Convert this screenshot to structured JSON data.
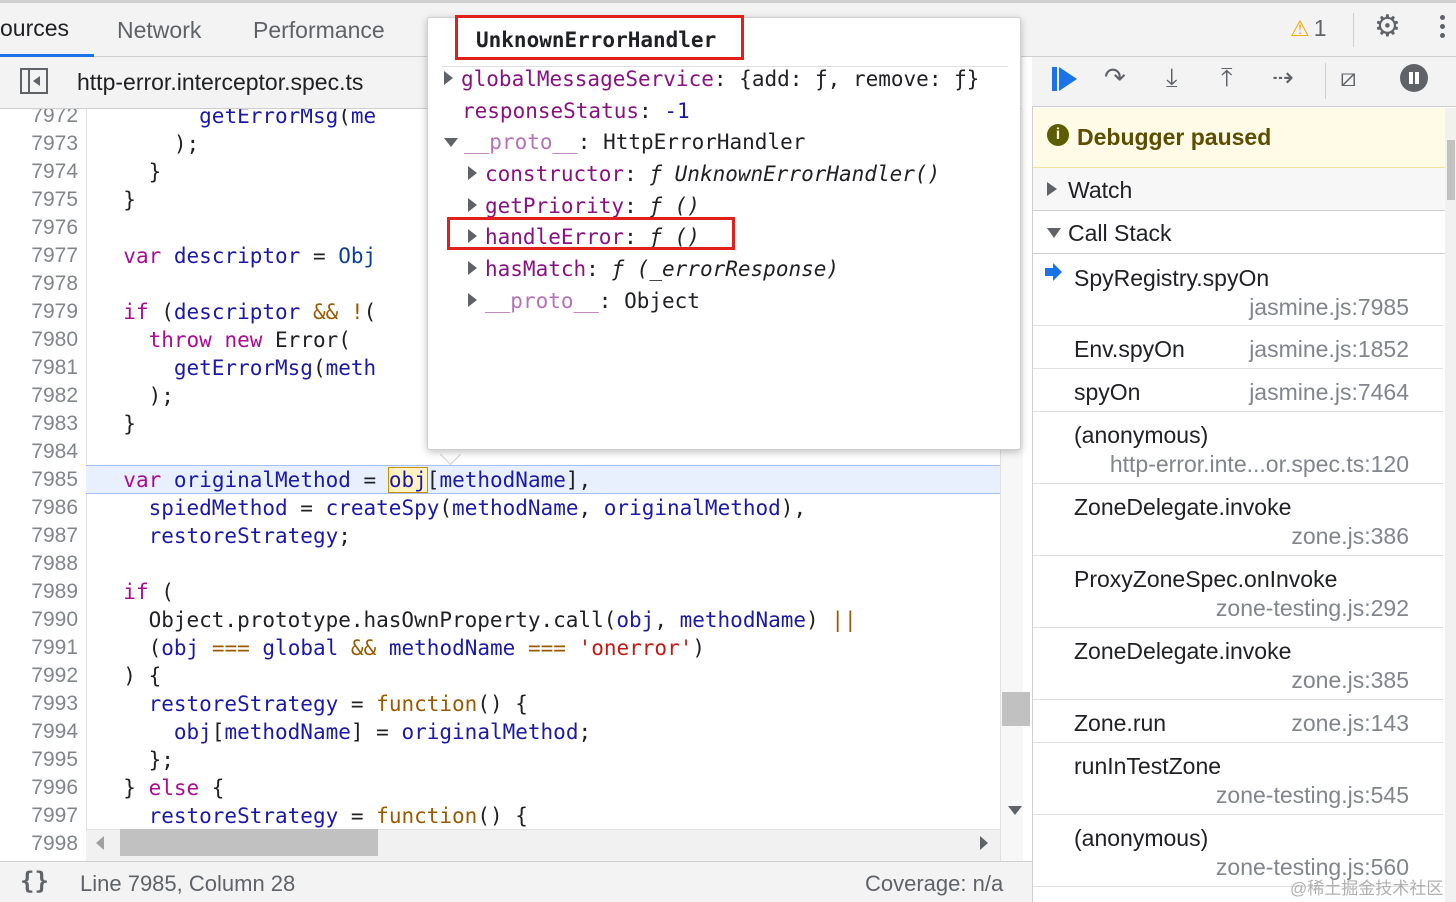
{
  "tabs": {
    "sources": "ources",
    "network": "Network",
    "performance": "Performance"
  },
  "warning_count": "1",
  "file_tab": "http-error.interceptor.spec.ts",
  "editor": {
    "lines": [
      {
        "n": "7972",
        "code": "        getErrorMsg(me"
      },
      {
        "n": "7973",
        "code": "      );"
      },
      {
        "n": "7974",
        "code": "    }"
      },
      {
        "n": "7975",
        "code": "  }"
      },
      {
        "n": "7976",
        "code": ""
      },
      {
        "n": "7977",
        "code": "  var descriptor = Obj"
      },
      {
        "n": "7978",
        "code": ""
      },
      {
        "n": "7979",
        "code": "  if (descriptor && !("
      },
      {
        "n": "7980",
        "code": "    throw new Error("
      },
      {
        "n": "7981",
        "code": "      getErrorMsg(meth"
      },
      {
        "n": "7982",
        "code": "    );"
      },
      {
        "n": "7983",
        "code": "  }"
      },
      {
        "n": "7984",
        "code": ""
      },
      {
        "n": "7985",
        "code": "  var originalMethod = obj[methodName],"
      },
      {
        "n": "7986",
        "code": "    spiedMethod = createSpy(methodName, originalMethod),"
      },
      {
        "n": "7987",
        "code": "    restoreStrategy;"
      },
      {
        "n": "7988",
        "code": ""
      },
      {
        "n": "7989",
        "code": "  if ("
      },
      {
        "n": "7990",
        "code": "    Object.prototype.hasOwnProperty.call(obj, methodName) ||"
      },
      {
        "n": "7991",
        "code": "    (obj === global && methodName === 'onerror')"
      },
      {
        "n": "7992",
        "code": "  ) {"
      },
      {
        "n": "7993",
        "code": "    restoreStrategy = function() {"
      },
      {
        "n": "7994",
        "code": "      obj[methodName] = originalMethod;"
      },
      {
        "n": "7995",
        "code": "    };"
      },
      {
        "n": "7996",
        "code": "  } else {"
      },
      {
        "n": "7997",
        "code": "    restoreStrategy = function() {"
      }
    ],
    "last_line_number": "7998"
  },
  "status": {
    "braces": "{}",
    "position": "Line 7985, Column 28",
    "coverage": "Coverage: n/a"
  },
  "popover": {
    "title": "UnknownErrorHandler",
    "rows": [
      {
        "key": "globalMessageService",
        "value": "{add: ƒ, remove: ƒ}"
      },
      {
        "key": "responseStatus",
        "value": "-1"
      },
      {
        "key": "__proto__",
        "value": "HttpErrorHandler"
      },
      {
        "key": "constructor",
        "value": "ƒ UnknownErrorHandler()"
      },
      {
        "key": "getPriority",
        "value": "ƒ ()"
      },
      {
        "key": "handleError",
        "value": "ƒ ()"
      },
      {
        "key": "hasMatch",
        "value": "ƒ (_errorResponse)"
      },
      {
        "key": "__proto__",
        "value": "Object"
      }
    ]
  },
  "debugger": {
    "paused_text": "Debugger paused",
    "paused_icon": "i",
    "watch_label": "Watch",
    "callstack_label": "Call Stack",
    "frames": [
      {
        "name": "SpyRegistry.spyOn",
        "location": "jasmine.js:7985"
      },
      {
        "name": "Env.spyOn",
        "location": "jasmine.js:1852"
      },
      {
        "name": "spyOn",
        "location": "jasmine.js:7464"
      },
      {
        "name": "(anonymous)",
        "location": "http-error.inte...or.spec.ts:120"
      },
      {
        "name": "ZoneDelegate.invoke",
        "location": "zone.js:386"
      },
      {
        "name": "ProxyZoneSpec.onInvoke",
        "location": "zone-testing.js:292"
      },
      {
        "name": "ZoneDelegate.invoke",
        "location": "zone.js:385"
      },
      {
        "name": "Zone.run",
        "location": "zone.js:143"
      },
      {
        "name": "runInTestZone",
        "location": "zone-testing.js:545"
      },
      {
        "name": "(anonymous)",
        "location": "zone-testing.js:560"
      }
    ]
  },
  "watermark": "@稀土掘金技术社区",
  "colors": {
    "accent": "#1a73e8",
    "highlight_box": "#e0201b",
    "paused_bg": "#fffbe6"
  },
  "icons": [
    "warning-icon",
    "gear-icon",
    "more-vert-icon",
    "navigator-toggle-icon",
    "resume-icon",
    "step-over-icon",
    "step-into-icon",
    "step-out-icon",
    "step-icon",
    "deactivate-breakpoints-icon",
    "pause-on-exceptions-icon",
    "info-icon",
    "current-frame-arrow-icon"
  ]
}
